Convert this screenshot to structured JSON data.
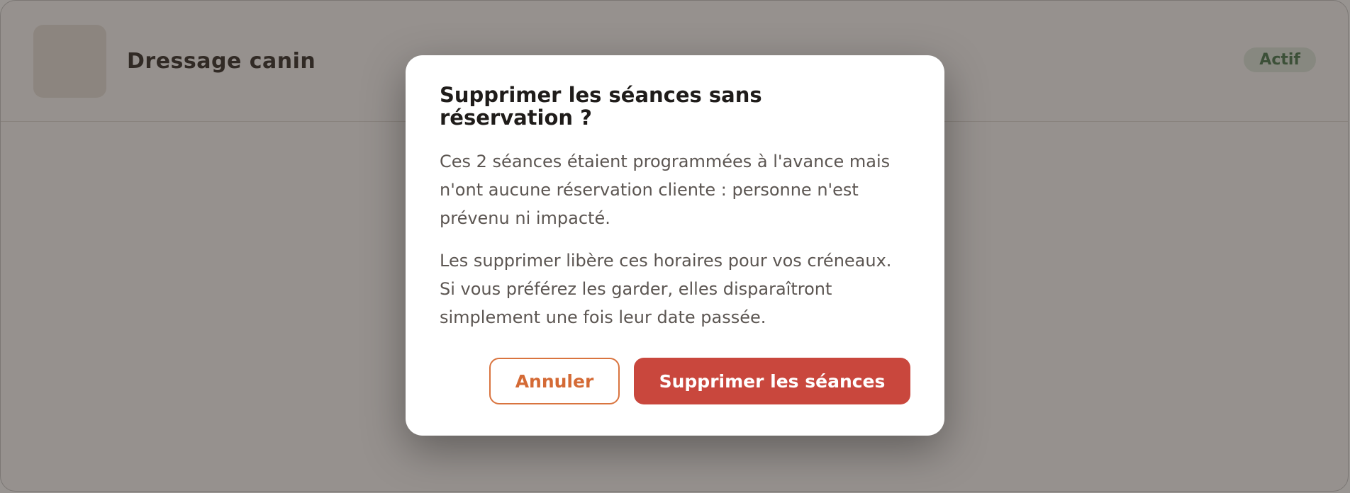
{
  "page": {
    "activity_title": "Dressage canin",
    "status_badge": "Actif"
  },
  "dialog": {
    "title": "Supprimer les séances sans réservation ?",
    "paragraph_1": "Ces 2 séances étaient programmées à l'avance mais n'ont aucune réservation cliente : personne n'est prévenu ni impacté.",
    "paragraph_2": "Les supprimer libère ces horaires pour vos créneaux. Si vous préférez les garder, elles disparaîtront simplement une fois leur date passée.",
    "cancel_label": "Annuler",
    "confirm_label": "Supprimer les séances"
  },
  "colors": {
    "accent": "#d9743f",
    "danger": "#c9473d",
    "status_green": "#4f7d55"
  }
}
